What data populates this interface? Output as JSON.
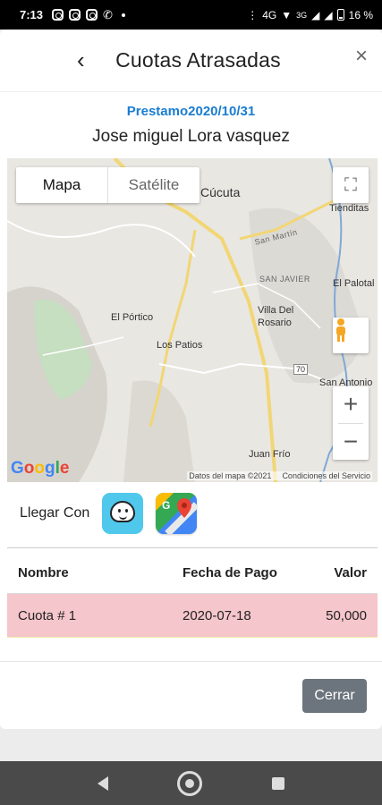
{
  "status_bar": {
    "time": "7:13",
    "network": "4G",
    "network2": "3G",
    "battery": "16 %"
  },
  "modal": {
    "back_glyph": "‹",
    "title": "Cuotas Atrasadas",
    "close_glyph": "×",
    "loan_label": "Prestamo2020/10/31",
    "client_name": "Jose miguel Lora vasquez"
  },
  "map": {
    "type_active": "Mapa",
    "type_inactive": "Satélite",
    "labels": {
      "cucuta": "Cúcuta",
      "tienditas": "Tienditas",
      "san_martin": "San Martín",
      "san_javier": "SAN JAVIER",
      "el_palotal": "El Palotal",
      "el_portico": "El Pórtico",
      "villa_del_rosario_1": "Villa Del",
      "villa_del_rosario_2": "Rosario",
      "los_patios": "Los Patios",
      "route_70": "70",
      "san_antonio": "San Antonio",
      "juan_frio": "Juan Frío"
    },
    "google_logo": [
      "G",
      "o",
      "o",
      "g",
      "l",
      "e"
    ],
    "attribution_data": "Datos del mapa ©2021",
    "attribution_terms": "Condiciones del Servicio",
    "zoom_in": "+",
    "zoom_out": "−"
  },
  "navigate_with": {
    "label": "Llegar Con",
    "apps": [
      "waze-icon",
      "google-maps-icon"
    ]
  },
  "table": {
    "headers": [
      "Nombre",
      "Fecha de Pago",
      "Valor"
    ],
    "rows": [
      {
        "name": "Cuota # 1",
        "date": "2020-07-18",
        "value": "50,000"
      }
    ],
    "row_color": "#f5c6cb"
  },
  "footer": {
    "close_label": "Cerrar"
  },
  "colors": {
    "accent": "#1a7dd0",
    "close_button": "#6c757d"
  }
}
